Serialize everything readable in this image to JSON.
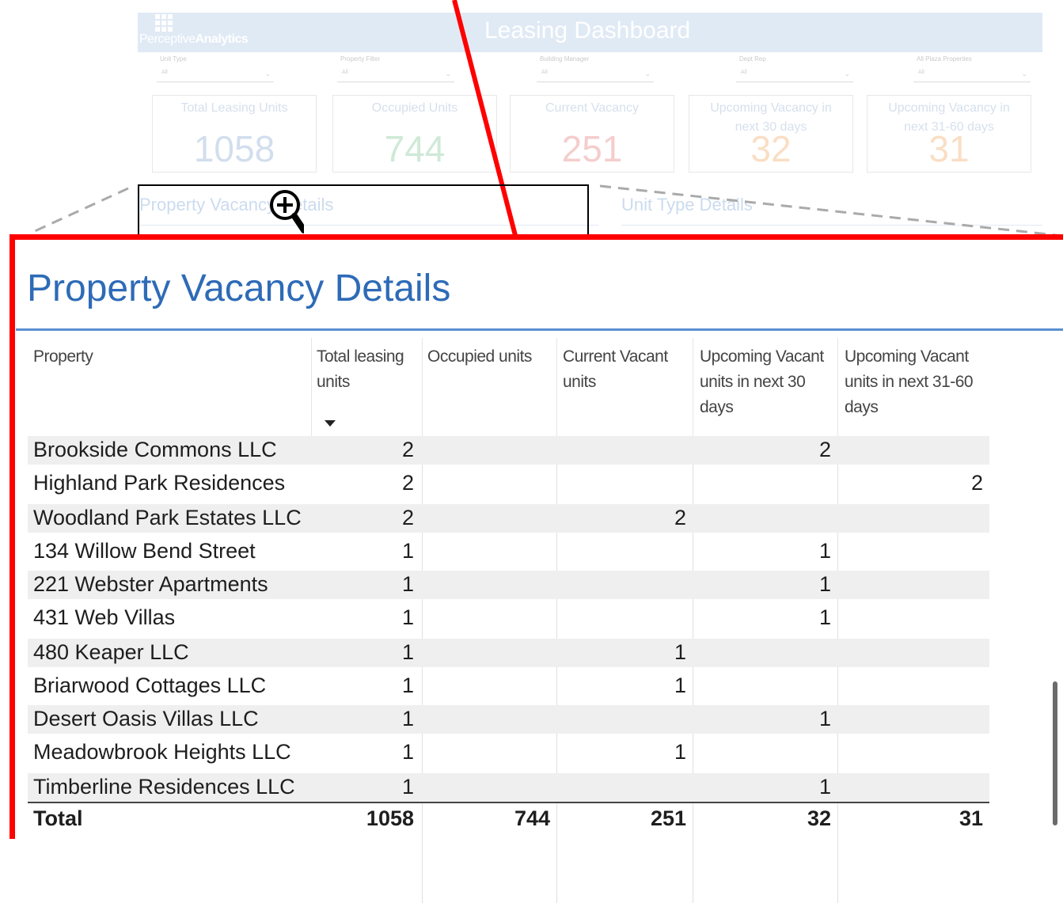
{
  "dashboard": {
    "logo": {
      "prefix": "Perceptive",
      "bold": "Analytics"
    },
    "title": "Leasing Dashboard",
    "filters": [
      {
        "label": "Unit Type",
        "value": "All"
      },
      {
        "label": "Property Filter",
        "value": "All"
      },
      {
        "label": "Building Manager",
        "value": "All"
      },
      {
        "label": "Dept Rep",
        "value": "All"
      },
      {
        "label": "All Plaza Properties",
        "value": "All"
      }
    ],
    "cards": [
      {
        "title": "Total Leasing Units",
        "value": "1058",
        "color": "#7fa3cf"
      },
      {
        "title": "Occupied Units",
        "value": "744",
        "color": "#79c38f"
      },
      {
        "title": "Current Vacancy",
        "value": "251",
        "color": "#e57373"
      },
      {
        "title": "Upcoming Vacancy in next 30 days",
        "value": "32",
        "color": "#f2a25a"
      },
      {
        "title": "Upcoming Vacancy in next 31-60 days",
        "value": "31",
        "color": "#f2a25a"
      }
    ],
    "sections": {
      "left": "Property Vacancy Details",
      "right": "Unit Type Details"
    }
  },
  "panel": {
    "title": "Property Vacancy Details",
    "columns": [
      "Property",
      "Total leasing units",
      "Occupied units",
      "Current Vacant units",
      "Upcoming Vacant units in next 30 days",
      "Upcoming Vacant units in next 31-60 days"
    ],
    "rows": [
      {
        "property": "Brookside Commons LLC",
        "total": "2",
        "occupied": "",
        "current": "",
        "next30": "2",
        "next60": ""
      },
      {
        "property": "Highland Park Residences",
        "total": "2",
        "occupied": "",
        "current": "",
        "next30": "",
        "next60": "2"
      },
      {
        "property": "Woodland Park Estates LLC",
        "total": "2",
        "occupied": "",
        "current": "2",
        "next30": "",
        "next60": ""
      },
      {
        "property": "134 Willow Bend Street",
        "total": "1",
        "occupied": "",
        "current": "",
        "next30": "1",
        "next60": ""
      },
      {
        "property": "221 Webster Apartments",
        "total": "1",
        "occupied": "",
        "current": "",
        "next30": "1",
        "next60": ""
      },
      {
        "property": "431 Web Villas",
        "total": "1",
        "occupied": "",
        "current": "",
        "next30": "1",
        "next60": ""
      },
      {
        "property": "480 Keaper LLC",
        "total": "1",
        "occupied": "",
        "current": "1",
        "next30": "",
        "next60": ""
      },
      {
        "property": "Briarwood Cottages LLC",
        "total": "1",
        "occupied": "",
        "current": "1",
        "next30": "",
        "next60": ""
      },
      {
        "property": "Desert Oasis Villas LLC",
        "total": "1",
        "occupied": "",
        "current": "",
        "next30": "1",
        "next60": ""
      },
      {
        "property": "Meadowbrook Heights LLC",
        "total": "1",
        "occupied": "",
        "current": "1",
        "next30": "",
        "next60": ""
      },
      {
        "property": "Timberline Residences LLC",
        "total": "1",
        "occupied": "",
        "current": "",
        "next30": "1",
        "next60": ""
      }
    ],
    "total": {
      "property": "Total",
      "total": "1058",
      "occupied": "744",
      "current": "251",
      "next30": "32",
      "next60": "31"
    }
  },
  "colors": {
    "accent": "#2e6bb7",
    "highlight": "#ff0000"
  }
}
